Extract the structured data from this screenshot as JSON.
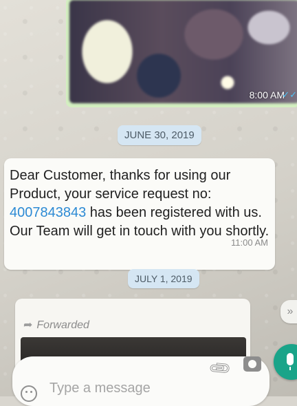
{
  "image_message": {
    "time": "8:00 AM",
    "tick_icon": "double-check-icon"
  },
  "date_separators": [
    "JUNE 30, 2019",
    "JULY 1, 2019"
  ],
  "message": {
    "text_before": "Dear Customer, thanks for using our Product, your service request no:",
    "request_number": "4007843843",
    "text_after": "has been registered with us. Our Team will get in touch with you shortly.",
    "time": "11:00 AM"
  },
  "forwarded_message": {
    "label": "Forwarded",
    "icon": "forward-arrow-icon"
  },
  "input_bar": {
    "placeholder": "Type a message",
    "icons": [
      "emoji-icon",
      "attach-clip-icon",
      "camera-icon",
      "mic-icon"
    ]
  },
  "colors": {
    "bubble_outgoing": "#d3efc0",
    "bubble_incoming": "#fbfbf8",
    "link": "#2c8ad4",
    "mic_button": "#1aa489",
    "date_chip": "#d5e6f3"
  }
}
